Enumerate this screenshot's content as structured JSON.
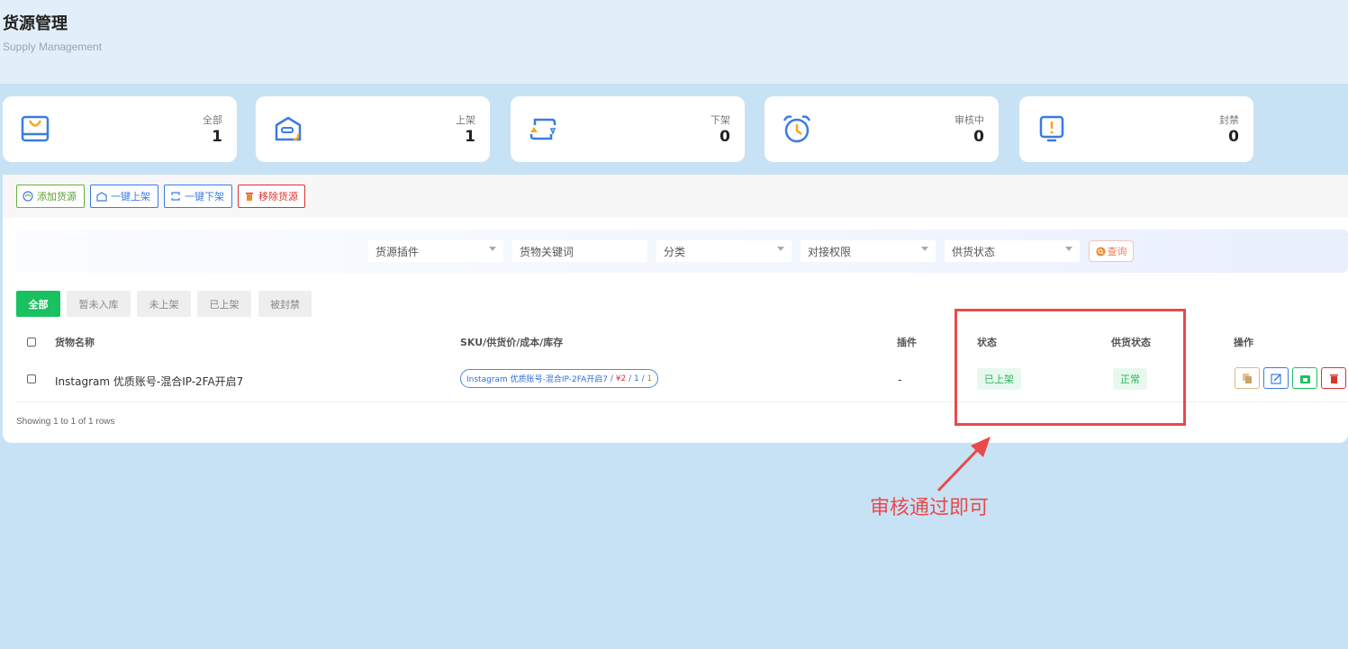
{
  "header": {
    "title": "货源管理",
    "subtitle": "Supply Management"
  },
  "stats": [
    {
      "label": "全部",
      "value": "1",
      "icon": "bag-icon"
    },
    {
      "label": "上架",
      "value": "1",
      "icon": "box-up-icon"
    },
    {
      "label": "下架",
      "value": "0",
      "icon": "refresh-down-icon"
    },
    {
      "label": "审核中",
      "value": "0",
      "icon": "alarm-clock-icon"
    },
    {
      "label": "封禁",
      "value": "0",
      "icon": "alert-square-icon"
    }
  ],
  "toolbar": {
    "add_label": "添加货源",
    "list_label": "一键上架",
    "delist_label": "一键下架",
    "remove_label": "移除货源"
  },
  "filters": {
    "plugin_placeholder": "货源插件",
    "keyword_placeholder": "货物关键词",
    "category_placeholder": "分类",
    "permission_placeholder": "对接权限",
    "supply_status_placeholder": "供货状态",
    "query_label": "查询"
  },
  "tabs": [
    "全部",
    "暂未入库",
    "未上架",
    "已上架",
    "被封禁"
  ],
  "table": {
    "columns": [
      "货物名称",
      "SKU/供货价/成本/库存",
      "插件",
      "状态",
      "供货状态",
      "操作"
    ],
    "rows": [
      {
        "name": "Instagram 优质账号-混合IP-2FA开启7",
        "sku_name": "Instagram 优质账号-混合IP-2FA开启7",
        "sep1": " / ",
        "price": "¥2",
        "sep2": " / ",
        "cost": "1",
        "sep3": " / ",
        "stock": "1",
        "plugin": "-",
        "status": "已上架",
        "supply_status": "正常"
      }
    ],
    "footer": "Showing 1 to 1 of 1 rows"
  },
  "annotation": {
    "text": "审核通过即可"
  },
  "colors": {
    "green": "#19c160",
    "blue": "#2e6fd8",
    "red": "#e84a4a",
    "orange": "#f08a2c"
  }
}
